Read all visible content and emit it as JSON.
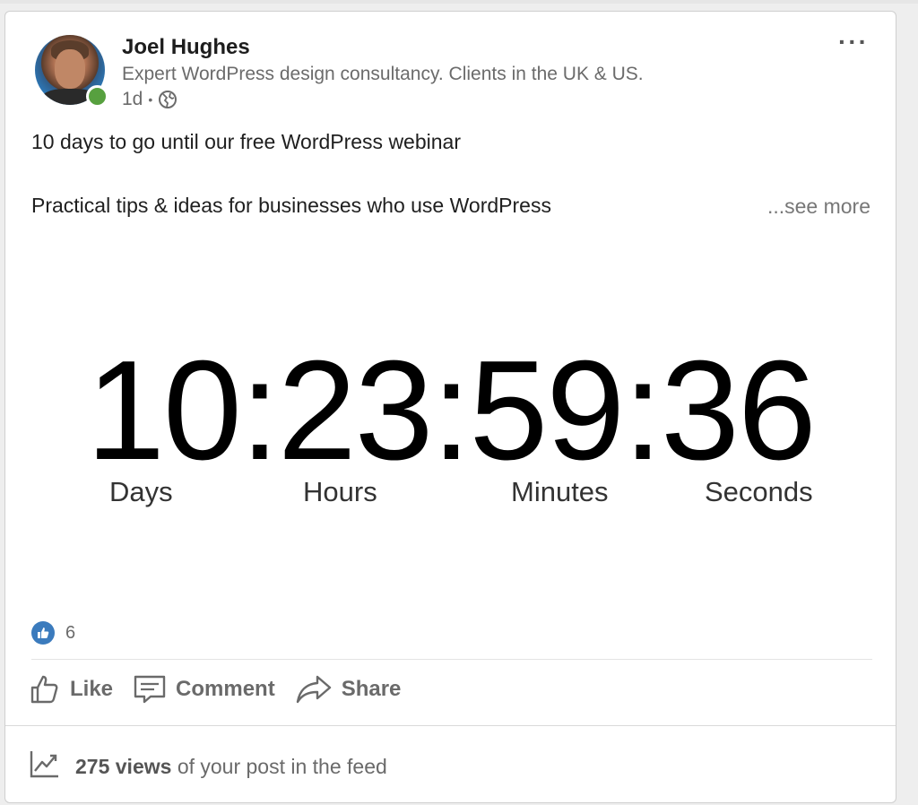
{
  "author": {
    "name": "Joel Hughes",
    "headline": "Expert WordPress design consultancy. Clients in the UK & US.",
    "time": "1d",
    "separator": "•",
    "presence_color": "#57a03f"
  },
  "menu": {
    "more_label": "···"
  },
  "post": {
    "line1": "10 days to go until our free WordPress webinar",
    "line2": "Practical tips & ideas for businesses who use WordPress",
    "see_more": "...see more"
  },
  "countdown": {
    "display": "10:23:59:36",
    "labels": {
      "days": "Days",
      "hours": "Hours",
      "minutes": "Minutes",
      "seconds": "Seconds"
    }
  },
  "reactions": {
    "count": "6",
    "icon": "thumbs-up-icon",
    "color": "#3b7bbd"
  },
  "actions": {
    "like": "Like",
    "comment": "Comment",
    "share": "Share"
  },
  "views": {
    "count_text": "275 views",
    "suffix_text": "of your post in the feed"
  }
}
